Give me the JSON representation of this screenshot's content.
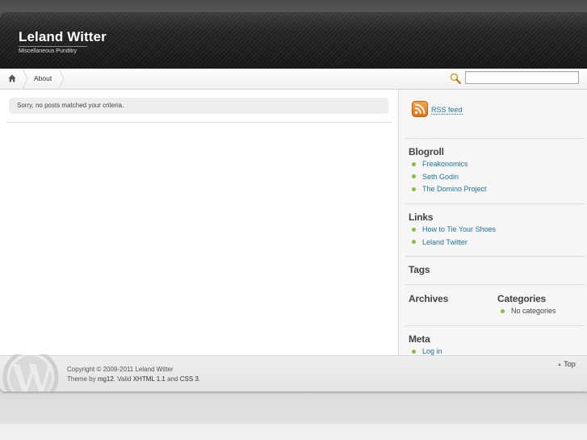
{
  "header": {
    "title": "Leland Witter",
    "tagline": "Miscellaneous Punditry"
  },
  "nav": {
    "home_icon": "home-icon",
    "items": [
      {
        "label": "About"
      }
    ]
  },
  "search": {
    "icon": "magnifier-icon",
    "value": "",
    "placeholder": ""
  },
  "content": {
    "notice": "Sorry, no posts matched your criteria."
  },
  "sidebar": {
    "rss_label": "RSS feed",
    "blogroll": {
      "heading": "Blogroll",
      "links": [
        "Freakonomics",
        "Seth Godin",
        "The Domino Project"
      ]
    },
    "links": {
      "heading": "Links",
      "links": [
        "How to Tie Your Shoes",
        "Leland Twitter"
      ]
    },
    "tags": {
      "heading": "Tags"
    },
    "archives": {
      "heading": "Archives"
    },
    "categories": {
      "heading": "Categories",
      "items": [
        "No categories"
      ]
    },
    "meta": {
      "heading": "Meta",
      "links": [
        "Log in"
      ]
    }
  },
  "footer": {
    "copyright": "Copyright © 2009-2011 Leland Witter",
    "theme_prefix": "Theme by",
    "theme_author": "mg12",
    "valid_prefix": ". Valid",
    "xhtml": "XHTML 1.1",
    "and": "and",
    "css": "CSS 3",
    "end": ".",
    "top_label": "Top",
    "top_arrow": "▲"
  },
  "colors": {
    "link": "#21759b",
    "bullet": "#88bb44",
    "header_bg": "#1a1a1a",
    "rss_orange": "#f08a24"
  }
}
